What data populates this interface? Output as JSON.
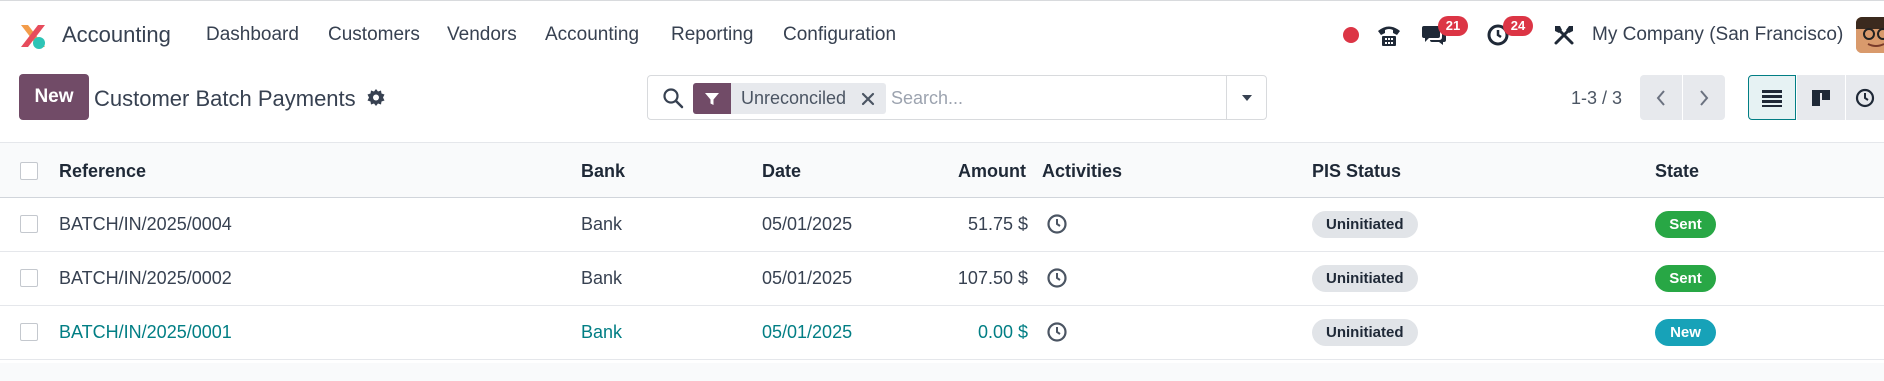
{
  "app": {
    "name": "Accounting"
  },
  "menu": [
    "Dashboard",
    "Customers",
    "Vendors",
    "Accounting",
    "Reporting",
    "Configuration"
  ],
  "systray": {
    "status_color": "#dc3545",
    "messages_badge": "21",
    "activities_badge": "24",
    "company": "My Company (San Francisco)"
  },
  "control": {
    "new_label": "New",
    "title": "Customer Batch Payments",
    "search_placeholder": "Search...",
    "facet_label": "Unreconciled",
    "pager": "1-3 / 3"
  },
  "table": {
    "headers": {
      "reference": "Reference",
      "bank": "Bank",
      "date": "Date",
      "amount": "Amount",
      "activities": "Activities",
      "pis_status": "PIS Status",
      "state": "State"
    },
    "rows": [
      {
        "reference": "BATCH/IN/2025/0004",
        "bank": "Bank",
        "date": "05/01/2025",
        "amount": "51.75 $",
        "pis_status": "Uninitiated",
        "state": "Sent"
      },
      {
        "reference": "BATCH/IN/2025/0002",
        "bank": "Bank",
        "date": "05/01/2025",
        "amount": "107.50 $",
        "pis_status": "Uninitiated",
        "state": "Sent"
      },
      {
        "reference": "BATCH/IN/2025/0001",
        "bank": "Bank",
        "date": "05/01/2025",
        "amount": "0.00 $",
        "pis_status": "Uninitiated",
        "state": "New"
      }
    ]
  },
  "colors": {
    "brand": "#714b67",
    "link": "#017e84",
    "state_sent": "#28a745",
    "state_new": "#17a2b8",
    "badge": "#dc3545"
  }
}
